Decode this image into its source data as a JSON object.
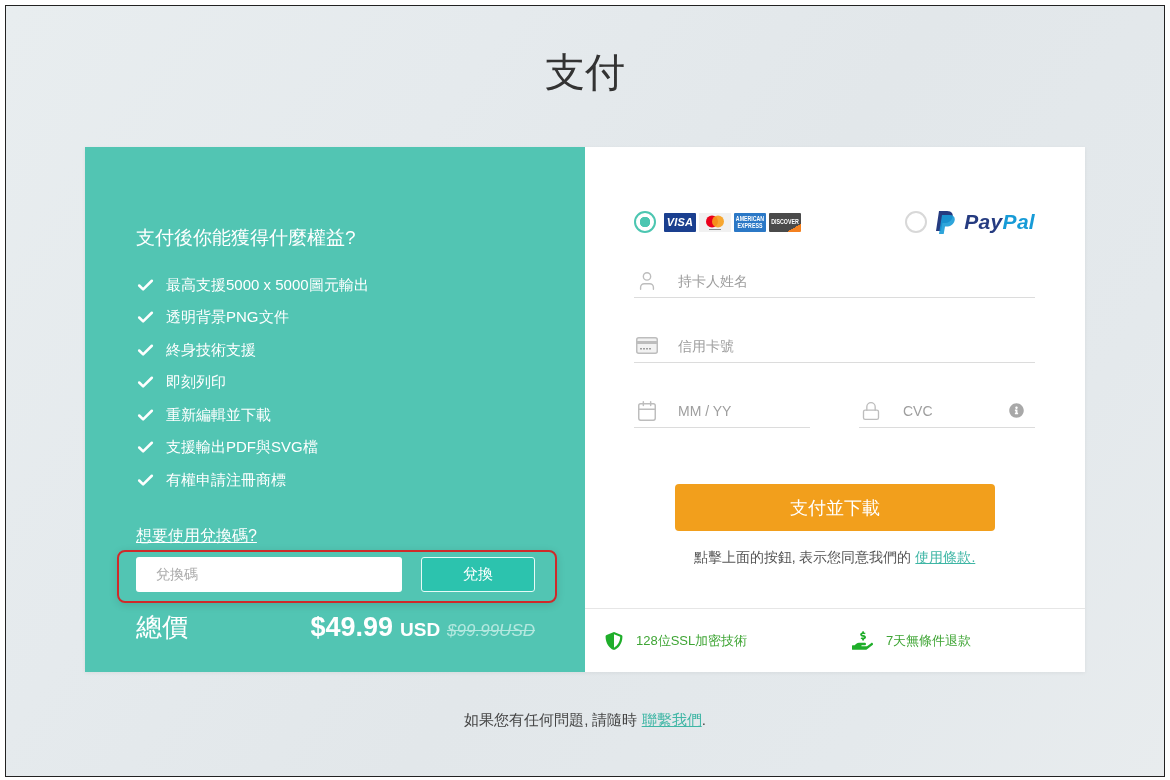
{
  "page": {
    "title": "支付"
  },
  "benefits": {
    "heading": "支付後你能獲得什麼權益?",
    "items": [
      "最高支援5000 x 5000圖元輸出",
      "透明背景PNG文件",
      "終身技術支援",
      "即刻列印",
      "重新編輯並下載",
      "支援輸出PDF與SVG檔",
      "有權申請注冊商標"
    ]
  },
  "voucher": {
    "link": "想要使用兌換碼?",
    "placeholder": "兌換碼",
    "button": "兌換",
    "highlighted": true
  },
  "total": {
    "label": "總價",
    "price": "$49.99",
    "currency": "USD",
    "original_price": "$99.99USD"
  },
  "payment_methods": [
    {
      "kind": "cards",
      "selected": true,
      "brands": [
        {
          "kind": "visa",
          "label": "VISA"
        },
        {
          "kind": "mastercard"
        },
        {
          "kind": "amex",
          "label": "AMERICAN EXPRESS"
        },
        {
          "kind": "discover",
          "label": "DISCOVER"
        }
      ]
    },
    {
      "kind": "paypal",
      "selected": false,
      "wordmark": [
        "Pay",
        "Pal"
      ]
    }
  ],
  "card_form": {
    "rows": [
      {
        "fields": [
          {
            "kind": "name",
            "placeholder": "持卡人姓名"
          }
        ]
      },
      {
        "fields": [
          {
            "kind": "card_number",
            "placeholder": "信用卡號"
          }
        ]
      },
      {
        "fields": [
          {
            "kind": "expiry",
            "placeholder": "MM / YY"
          },
          {
            "kind": "cvc",
            "placeholder": "CVC"
          }
        ]
      }
    ]
  },
  "pay_button": "支付並下載",
  "terms": {
    "text": "點擊上面的按鈕, 表示您同意我們的",
    "link": "使用條款."
  },
  "guarantees": [
    {
      "kind": "ssl",
      "label": "128位SSL加密技術"
    },
    {
      "kind": "refund",
      "label": "7天無條件退款"
    }
  ],
  "footer": {
    "text": "如果您有任何問題, 請隨時",
    "link": "聯繫我們",
    "suffix": "."
  }
}
